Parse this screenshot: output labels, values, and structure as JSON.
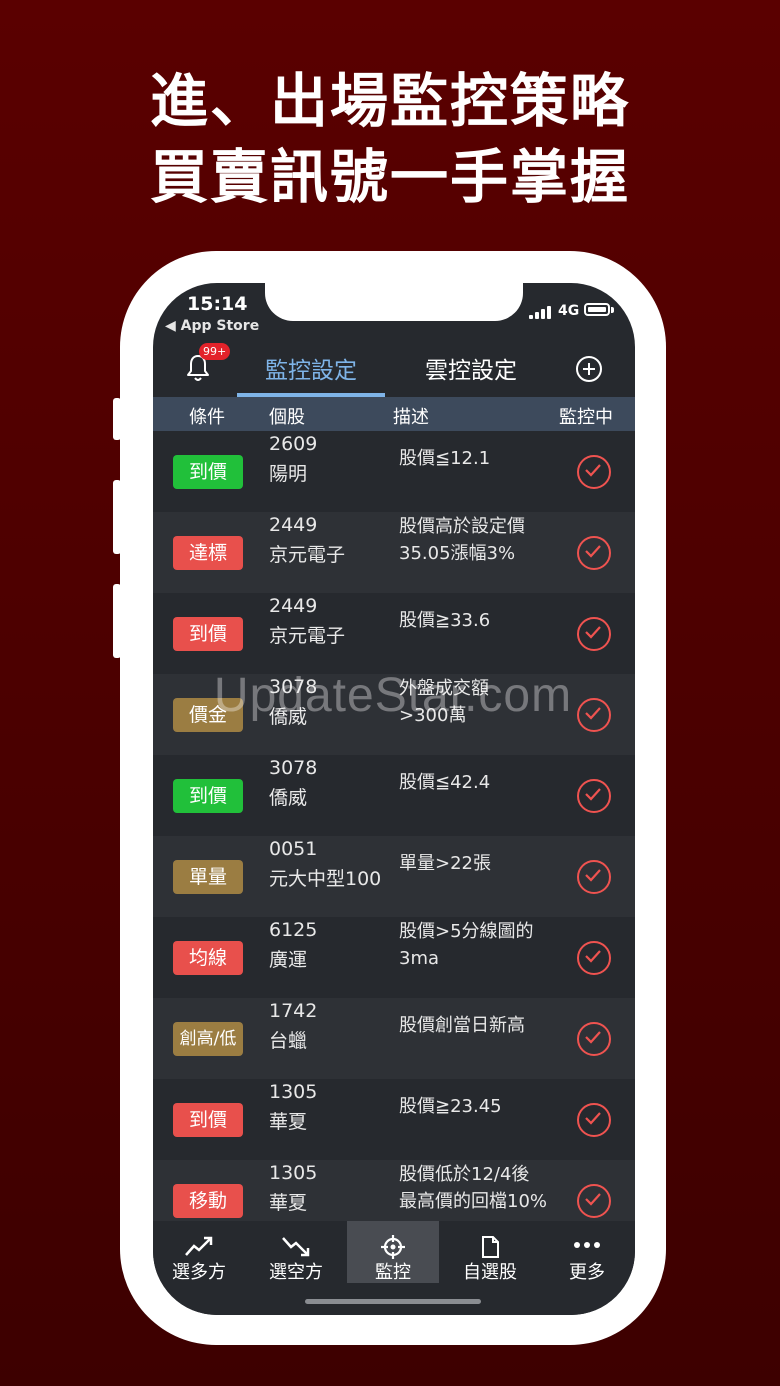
{
  "headline": {
    "line1": "進、出場監控策略",
    "line2": "買賣訊號一手掌握"
  },
  "status_bar": {
    "time": "15:14",
    "back_app": "◀ App Store",
    "network": "4G"
  },
  "top_nav": {
    "badge": "99+",
    "tabs": [
      {
        "label": "監控設定",
        "active": true
      },
      {
        "label": "雲控設定",
        "active": false
      }
    ]
  },
  "columns": {
    "condition": "條件",
    "stock": "個股",
    "description": "描述",
    "monitoring": "監控中"
  },
  "rows": [
    {
      "tag": "到價",
      "tag_color": "#21c03a",
      "code": "2609",
      "name": "陽明",
      "desc": "股價≦12.1"
    },
    {
      "tag": "達標",
      "tag_color": "#e8504c",
      "code": "2449",
      "name": "京元電子",
      "desc": "股價高於設定價\n35.05漲幅3%"
    },
    {
      "tag": "到價",
      "tag_color": "#e8504c",
      "code": "2449",
      "name": "京元電子",
      "desc": "股價≧33.6"
    },
    {
      "tag": "價金",
      "tag_color": "#9b7d42",
      "code": "3078",
      "name": "僑威",
      "desc": "外盤成交額\n>300萬"
    },
    {
      "tag": "到價",
      "tag_color": "#21c03a",
      "code": "3078",
      "name": "僑威",
      "desc": "股價≦42.4"
    },
    {
      "tag": "單量",
      "tag_color": "#9b7d42",
      "code": "0051",
      "name": "元大中型100",
      "desc": "單量>22張"
    },
    {
      "tag": "均線",
      "tag_color": "#e8504c",
      "code": "6125",
      "name": "廣運",
      "desc": "股價>5分線圖的\n3ma"
    },
    {
      "tag": "創高/低",
      "tag_color": "#9b7d42",
      "code": "1742",
      "name": "台蠟",
      "desc": "股價創當日新高"
    },
    {
      "tag": "到價",
      "tag_color": "#e8504c",
      "code": "1305",
      "name": "華夏",
      "desc": "股價≧23.45"
    },
    {
      "tag": "移動",
      "tag_color": "#e8504c",
      "code": "1305",
      "name": "華夏",
      "desc": "股價低於12/4後\n最高價的回檔10%"
    }
  ],
  "watermark": "UpdateStar.com",
  "bottom_nav": [
    {
      "label": "選多方",
      "icon": "trend-up-icon",
      "active": false
    },
    {
      "label": "選空方",
      "icon": "trend-down-icon",
      "active": false
    },
    {
      "label": "監控",
      "icon": "crosshair-icon",
      "active": true
    },
    {
      "label": "自選股",
      "icon": "document-icon",
      "active": false
    },
    {
      "label": "更多",
      "icon": "more-dots-icon",
      "active": false
    }
  ]
}
